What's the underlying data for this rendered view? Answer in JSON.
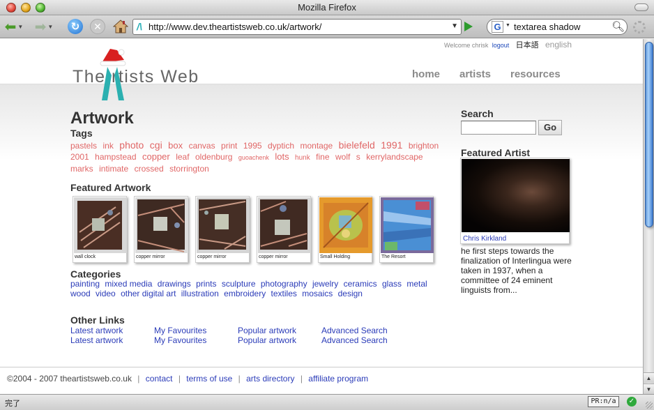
{
  "window": {
    "title": "Mozilla Firefox"
  },
  "toolbar": {
    "url": "http://www.dev.theartistsweb.co.uk/artwork/",
    "search_query": "textarea shadow",
    "search_engine": "G"
  },
  "topbar": {
    "welcome": "Welcome chrisk",
    "logout": "logout",
    "lang_ja": "日本語",
    "lang_en": "english"
  },
  "logo": {
    "text": "The  rtists Web"
  },
  "nav": {
    "home": "home",
    "artists": "artists",
    "resources": "resources"
  },
  "main": {
    "title": "Artwork",
    "tags_heading": "Tags",
    "tags": [
      {
        "t": "pastels",
        "s": 12
      },
      {
        "t": "ink",
        "s": 12
      },
      {
        "t": "photo",
        "s": 14
      },
      {
        "t": "cgi",
        "s": 14
      },
      {
        "t": "box",
        "s": 13
      },
      {
        "t": "canvas",
        "s": 12
      },
      {
        "t": "print",
        "s": 12
      },
      {
        "t": "1995",
        "s": 12
      },
      {
        "t": "dyptich",
        "s": 12
      },
      {
        "t": "montage",
        "s": 12
      },
      {
        "t": "bielefeld",
        "s": 14
      },
      {
        "t": "1991",
        "s": 14
      },
      {
        "t": "brighton",
        "s": 12
      },
      {
        "t": "2001",
        "s": 12
      },
      {
        "t": "hampstead",
        "s": 12
      },
      {
        "t": "copper",
        "s": 13
      },
      {
        "t": "leaf",
        "s": 12
      },
      {
        "t": "oldenburg",
        "s": 12
      },
      {
        "t": "guoachenk",
        "s": 9
      },
      {
        "t": "lots",
        "s": 13
      },
      {
        "t": "hunk",
        "s": 10
      },
      {
        "t": "fine",
        "s": 12
      },
      {
        "t": "wolf",
        "s": 12
      },
      {
        "t": "s",
        "s": 12
      },
      {
        "t": "kerrylandscape",
        "s": 12
      },
      {
        "t": "marks",
        "s": 12
      },
      {
        "t": "intimate",
        "s": 12
      },
      {
        "t": "crossed",
        "s": 12
      },
      {
        "t": "storrington",
        "s": 12
      }
    ],
    "featured_heading": "Featured Artwork",
    "featured": [
      {
        "caption": "wall clock",
        "kind": "mirror-a"
      },
      {
        "caption": "copper mirror",
        "kind": "mirror-b"
      },
      {
        "caption": "copper mirror",
        "kind": "mirror-c"
      },
      {
        "caption": "copper mirror",
        "kind": "mirror-d"
      },
      {
        "caption": "Small Holding",
        "kind": "painting-orange"
      },
      {
        "caption": "The Resort",
        "kind": "painting-blue"
      }
    ],
    "categories_heading": "Categories",
    "categories": [
      "painting",
      "mixed media",
      "drawings",
      "prints",
      "sculpture",
      "photography",
      "jewelry",
      "ceramics",
      "glass",
      "metal",
      "wood",
      "video",
      "other digital art",
      "illustration",
      "embroidery",
      "textiles",
      "mosaics",
      "design"
    ],
    "other_links_heading": "Other Links",
    "other_links": {
      "col1": [
        "Latest artwork",
        "Latest artwork"
      ],
      "col2": [
        "My Favourites",
        "My Favourites"
      ],
      "col3": [
        "Popular artwork",
        "Popular artwork"
      ],
      "col4": [
        "Advanced Search",
        "Advanced Search"
      ]
    }
  },
  "sidebar": {
    "search_heading": "Search",
    "search_button": "Go",
    "featured_artist_heading": "Featured Artist",
    "featured_artist_name": "Chris Kirkland",
    "featured_artist_text": "he first steps towards the finalization of Interlingua were taken in 1937, when a committee of 24 eminent linguists from..."
  },
  "footer": {
    "copyright": "©2004 - 2007 theartistsweb.co.uk",
    "links": [
      "contact",
      "terms of use",
      "arts directory",
      "affiliate program"
    ]
  },
  "statusbar": {
    "text": "完了",
    "pr": "PR:n/a"
  },
  "colors": {
    "tag": "#e06666",
    "link": "#2a3bb8",
    "heading": "#333333",
    "nav": "#8a8a8a"
  }
}
